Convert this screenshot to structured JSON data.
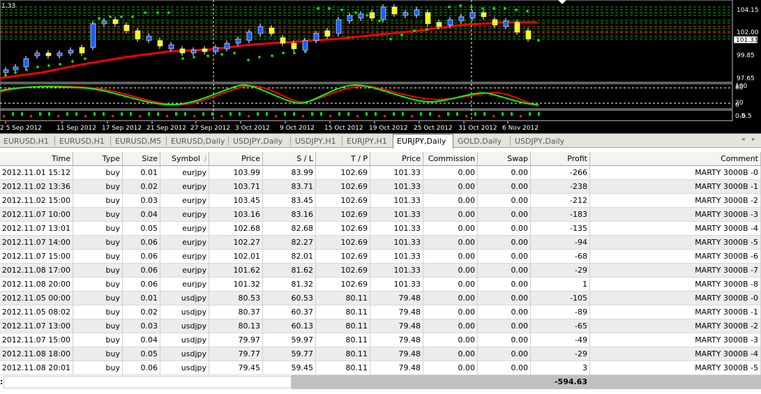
{
  "chart": {
    "price_corner": "1.33",
    "price_axis": [
      "104.15",
      "102.00",
      "101.33",
      "99.85",
      "97.65"
    ],
    "osc_axis": [
      "100",
      "80",
      "20",
      "0"
    ],
    "vol_axis": [
      "0.5",
      "-0.5"
    ],
    "dates": [
      "2 5 Sep 2012",
      "11 Sep 2012",
      "17 Sep 2012",
      "21 Sep 2012",
      "27 Sep 2012",
      "3 Oct 2012",
      "9 Oct 2012",
      "15 Oct 2012",
      "19 Oct 2012",
      "25 Oct 2012",
      "31 Oct 2012",
      "6 Nov 2012"
    ],
    "colors": {
      "background": "#000000",
      "bull_candle": "#1e5eff",
      "bear_candle": "#ffff00",
      "ma_line": "#ff0000",
      "sar_dots": "#00ff00",
      "grid_dashed": "#00aa00",
      "osc_red": "#ff0000",
      "osc_green": "#00ff00"
    }
  },
  "tabs": [
    {
      "label": "EURUSD,H1",
      "active": false
    },
    {
      "label": "EURUSD,H1",
      "active": false
    },
    {
      "label": "EURUSD,M5",
      "active": false
    },
    {
      "label": "EURUSD,Daily",
      "active": false
    },
    {
      "label": "USDJPY,Daily",
      "active": false
    },
    {
      "label": "USDJPY,H1",
      "active": false
    },
    {
      "label": "EURJPY,H1",
      "active": false
    },
    {
      "label": "EURJPY,Daily",
      "active": true
    },
    {
      "label": "GOLD,Daily",
      "active": false
    },
    {
      "label": "USDJPY,Daily",
      "active": false
    }
  ],
  "table": {
    "columns": [
      "Time",
      "Type",
      "Size",
      "Symbol",
      "Price",
      "S / L",
      "T / P",
      "Price",
      "Commission",
      "Swap",
      "Profit",
      "Comment"
    ],
    "sort_mark": "/",
    "rows": [
      [
        "2012.11.01 15:12",
        "buy",
        "0.01",
        "eurjpy",
        "103.99",
        "83.99",
        "102.69",
        "101.33",
        "0.00",
        "0.00",
        "-266",
        "MARTY 3000B -0"
      ],
      [
        "2012.11.02 13:36",
        "buy",
        "0.02",
        "eurjpy",
        "103.71",
        "83.71",
        "102.69",
        "101.33",
        "0.00",
        "0.00",
        "-238",
        "MARTY 3000B -1"
      ],
      [
        "2012.11.02 15:00",
        "buy",
        "0.03",
        "eurjpy",
        "103.45",
        "83.45",
        "102.69",
        "101.33",
        "0.00",
        "0.00",
        "-212",
        "MARTY 3000B -2"
      ],
      [
        "2012.11.07 10:00",
        "buy",
        "0.04",
        "eurjpy",
        "103.16",
        "83.16",
        "102.69",
        "101.33",
        "0.00",
        "0.00",
        "-183",
        "MARTY 3000B -3"
      ],
      [
        "2012.11.07 13:01",
        "buy",
        "0.05",
        "eurjpy",
        "102.68",
        "82.68",
        "102.69",
        "101.33",
        "0.00",
        "0.00",
        "-135",
        "MARTY 3000B -4"
      ],
      [
        "2012.11.07 14:00",
        "buy",
        "0.06",
        "eurjpy",
        "102.27",
        "82.27",
        "102.69",
        "101.33",
        "0.00",
        "0.00",
        "-94",
        "MARTY 3000B -5"
      ],
      [
        "2012.11.07 15:00",
        "buy",
        "0.06",
        "eurjpy",
        "102.01",
        "82.01",
        "102.69",
        "101.33",
        "0.00",
        "0.00",
        "-68",
        "MARTY 3000B -6"
      ],
      [
        "2012.11.08 17:00",
        "buy",
        "0.06",
        "eurjpy",
        "101.62",
        "81.62",
        "102.69",
        "101.33",
        "0.00",
        "0.00",
        "-29",
        "MARTY 3000B -7"
      ],
      [
        "2012.11.08 20:00",
        "buy",
        "0.06",
        "eurjpy",
        "101.32",
        "81.32",
        "102.69",
        "101.33",
        "0.00",
        "0.00",
        "1",
        "MARTY 3000B -8"
      ],
      [
        "2012.11.05 00:00",
        "buy",
        "0.01",
        "usdjpy",
        "80.53",
        "60.53",
        "80.11",
        "79.48",
        "0.00",
        "0.00",
        "-105",
        "MARTY 3000B -0"
      ],
      [
        "2012.11.05 08:02",
        "buy",
        "0.02",
        "usdjpy",
        "80.37",
        "60.37",
        "80.11",
        "79.48",
        "0.00",
        "0.00",
        "-89",
        "MARTY 3000B -1"
      ],
      [
        "2012.11.07 13:00",
        "buy",
        "0.03",
        "usdjpy",
        "80.13",
        "60.13",
        "80.11",
        "79.48",
        "0.00",
        "0.00",
        "-65",
        "MARTY 3000B -2"
      ],
      [
        "2012.11.07 15:00",
        "buy",
        "0.04",
        "usdjpy",
        "79.97",
        "59.97",
        "80.11",
        "79.48",
        "0.00",
        "0.00",
        "-49",
        "MARTY 3000B -3"
      ],
      [
        "2012.11.08 18:00",
        "buy",
        "0.05",
        "usdjpy",
        "79.77",
        "59.77",
        "80.11",
        "79.48",
        "0.00",
        "0.00",
        "-29",
        "MARTY 3000B -4"
      ],
      [
        "2012.11.08 20:01",
        "buy",
        "0.06",
        "usdjpy",
        "79.45",
        "59.45",
        "80.11",
        "79.48",
        "0.00",
        "0.00",
        "3",
        "MARTY 3000B -5"
      ]
    ]
  },
  "summary": {
    "colon": ":",
    "total": "-594.63"
  }
}
